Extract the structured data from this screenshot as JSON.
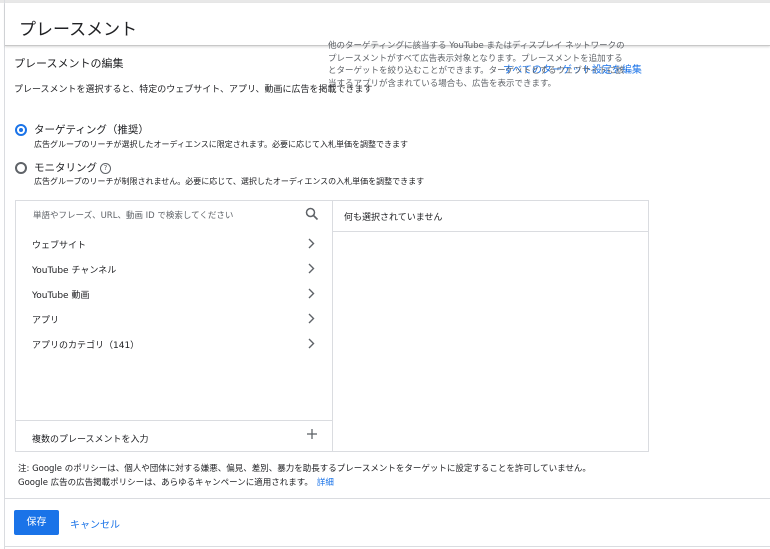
{
  "header": {
    "title": "プレースメント"
  },
  "section": {
    "title": "プレースメントの編集",
    "edit_all_link": "すべてのターゲット設定を編集",
    "description": "プレースメントを選択すると、特定のウェブサイト、アプリ、動画に広告を掲載できます"
  },
  "options": {
    "targeting": {
      "label": "ターゲティング（推奨）",
      "description": "広告グループのリーチが選択したオーディエンスに限定されます。必要に応じて入札単価を調整できます",
      "selected": true
    },
    "monitoring": {
      "label": "モニタリング",
      "help_icon": "?",
      "description": "広告グループのリーチが制限されません。必要に応じて、選択したオーディエンスの入札単価を調整できます",
      "selected": false
    }
  },
  "browser": {
    "search_placeholder": "単語やフレーズ、URL、動画 ID で検索してください",
    "items": [
      {
        "label": "ウェブサイト"
      },
      {
        "label": "YouTube チャンネル"
      },
      {
        "label": "YouTube 動画"
      },
      {
        "label": "アプリ"
      },
      {
        "label": "アプリのカテゴリ（141）"
      }
    ],
    "multi_entry_label": "複数のプレースメントを入力"
  },
  "selection": {
    "header": "何も選択されていません",
    "body": "他のターゲティングに該当する YouTube またはディスプレイ ネットワークのプレースメントがすべて広告表示対象となります。プレースメントを追加するとターゲットを絞り込むことができます。ターゲットとするウェブサイトに該当するアプリが含まれている場合も、広告を表示できます。"
  },
  "notes": {
    "line1": "注: Google のポリシーは、個人や団体に対する嫌悪、偏見、差別、暴力を助長するプレースメントをターゲットに設定することを許可していません。",
    "line2": "Google 広告の広告掲載ポリシーは、あらゆるキャンペーンに適用されます。",
    "details_link": "詳細"
  },
  "footer": {
    "save_label": "保存",
    "cancel_label": "キャンセル"
  },
  "colors": {
    "accent": "#1a73e8",
    "text": "#202124",
    "muted": "#5f6368",
    "border": "#dadce0"
  },
  "icons": {
    "search": "search-icon",
    "chevron": "chevron-right-icon",
    "plus": "plus-icon"
  }
}
